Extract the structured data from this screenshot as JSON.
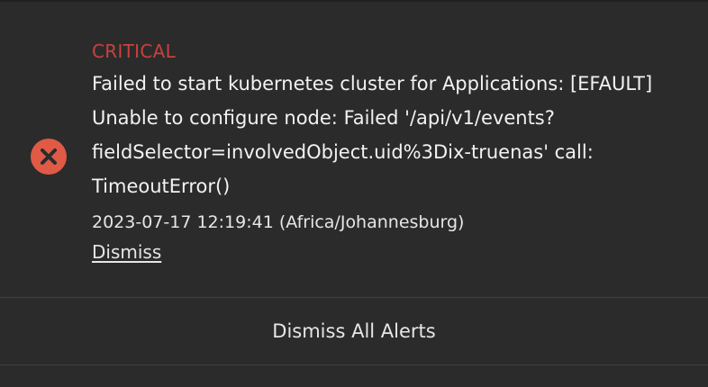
{
  "alert": {
    "level": "CRITICAL",
    "message_lines": [
      "Failed to start kubernetes cluster for Applications: [EFAULT]",
      "Unable to configure node: Failed '/api/v1/events?",
      "fieldSelector=involvedObject.uid%3Dix-truenas' call:",
      "TimeoutError()"
    ],
    "timestamp": "2023-07-17 12:19:41 (Africa/Johannesburg)",
    "dismiss_label": "Dismiss",
    "icon": "error-circle-x-icon"
  },
  "footer": {
    "dismiss_all_label": "Dismiss All Alerts"
  },
  "colors": {
    "critical": "#c9423b",
    "icon_fill": "#e05a46",
    "background": "#2b2b2b",
    "text": "#f2f2f2"
  }
}
